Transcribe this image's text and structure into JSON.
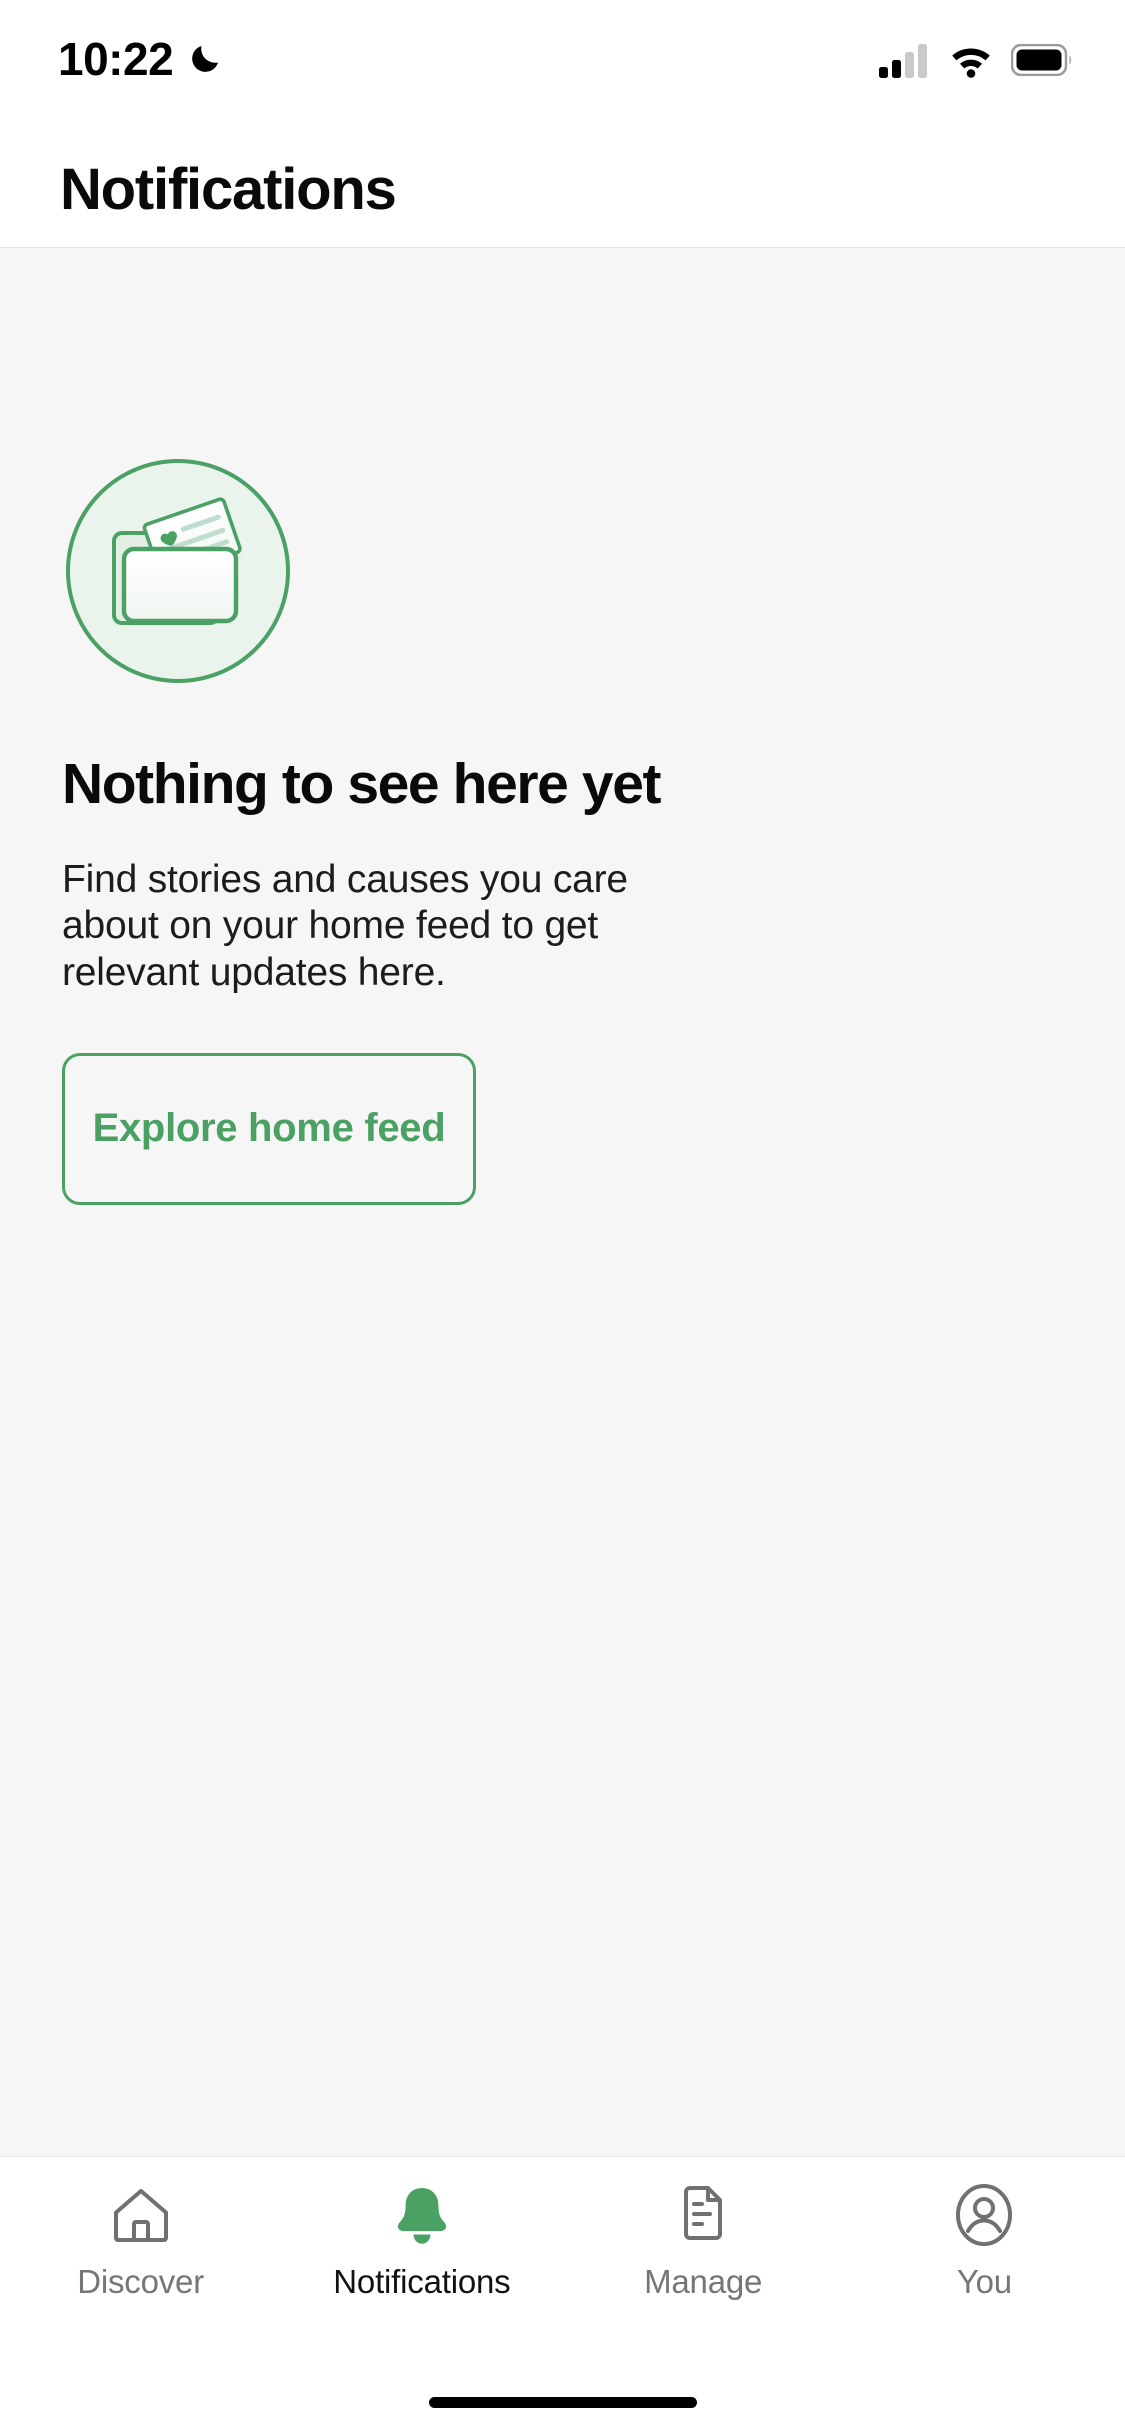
{
  "status_bar": {
    "time": "10:22",
    "dnd_icon": "crescent-moon-icon",
    "signal_icon": "cellular-signal-icon",
    "wifi_icon": "wifi-icon",
    "battery_icon": "battery-icon",
    "signal_bars_filled": 2,
    "signal_bars_total": 4
  },
  "header": {
    "title": "Notifications"
  },
  "empty_state": {
    "illustration_name": "folder-with-card-illustration",
    "heading": "Nothing to see here yet",
    "body": "Find stories and causes you care about on your home feed to get relevant updates here.",
    "cta_label": "Explore home feed"
  },
  "tabs": [
    {
      "label": "Discover",
      "icon": "home-icon",
      "active": false
    },
    {
      "label": "Notifications",
      "icon": "bell-icon",
      "active": true
    },
    {
      "label": "Manage",
      "icon": "document-icon",
      "active": false
    },
    {
      "label": "You",
      "icon": "person-circle-icon",
      "active": false
    }
  ],
  "colors": {
    "accent_green": "#4aa163",
    "illustration_fill": "#eaf4ec",
    "content_background": "#f6f6f6",
    "surface": "#ffffff",
    "text_primary": "#0a0a0a",
    "text_muted": "#767676"
  },
  "home_indicator": "home-indicator-bar"
}
